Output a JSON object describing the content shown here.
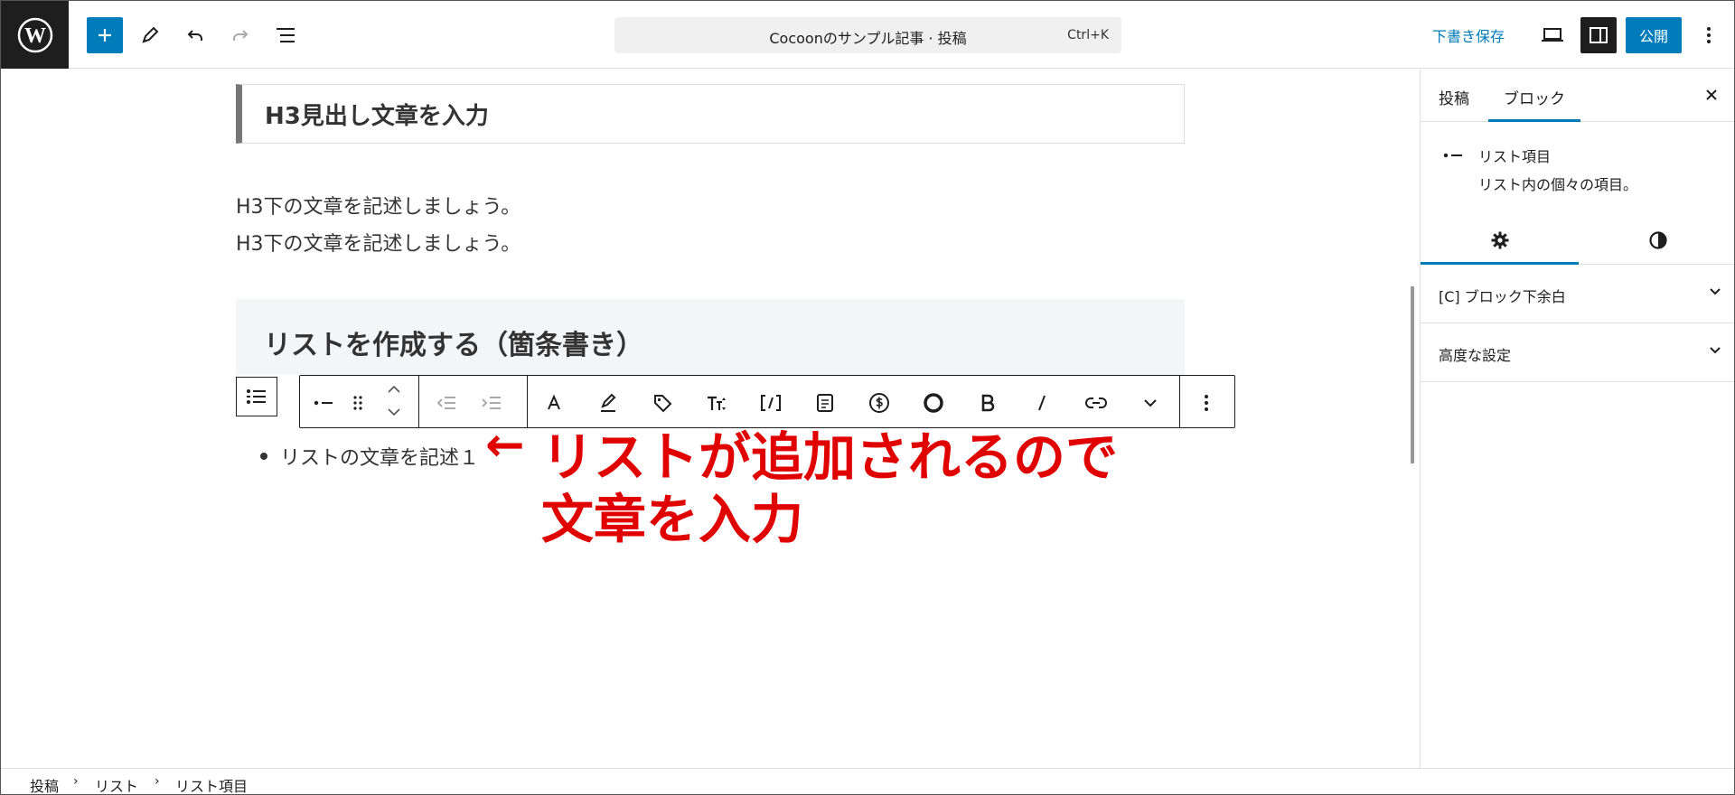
{
  "header": {
    "document_title": "Cocoonのサンプル記事 · 投稿",
    "shortcut": "Ctrl+K",
    "save_draft_label": "下書き保存",
    "publish_label": "公開",
    "accent_color": "#007cba"
  },
  "editor": {
    "h3_heading": "H3見出し文章を入力",
    "paragraph_lines": [
      "H3下の文章を記述しましょう。",
      "H3下の文章を記述しましょう。"
    ],
    "h2_heading": "リストを作成する（箇条書き）",
    "list_items": [
      "リストの文章を記述１"
    ],
    "annotation": {
      "arrow": "←",
      "line1": "リストが追加されるので",
      "line2": "文章を入力",
      "color": "#e00000"
    },
    "toolbar_icons": [
      "list-item-icon",
      "drag-handle-icon",
      "move-up-icon",
      "move-down-icon",
      "outdent-icon",
      "indent-icon",
      "font-icon",
      "highlight-icon",
      "tag-icon",
      "font-size-icon",
      "shortcode-icon",
      "document-icon",
      "dollar-icon",
      "circle-icon",
      "bold-icon",
      "italic-icon",
      "link-icon",
      "more-chevron-icon",
      "options-icon"
    ]
  },
  "sidebar": {
    "tabs": [
      "投稿",
      "ブロック"
    ],
    "active_tab": "ブロック",
    "block_card": {
      "title": "リスト項目",
      "description": "リスト内の個々の項目。"
    },
    "panels": [
      "[C] ブロック下余白",
      "高度な設定"
    ]
  },
  "breadcrumbs": [
    "投稿",
    "リスト",
    "リスト項目"
  ]
}
